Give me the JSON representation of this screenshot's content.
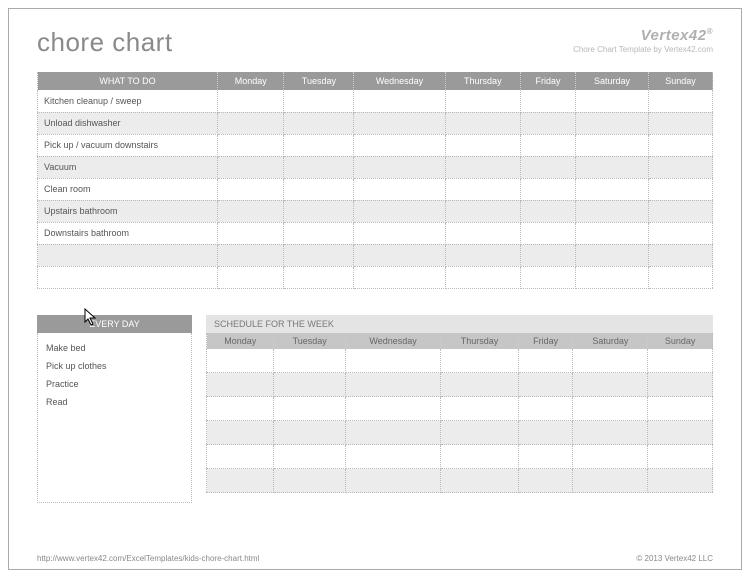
{
  "header": {
    "title": "chore chart",
    "brand_name": "Vertex42",
    "brand_reg": "®",
    "brand_sub": "Chore Chart Template by Vertex42.com"
  },
  "main_table": {
    "col_header": "WHAT TO DO",
    "days": [
      "Monday",
      "Tuesday",
      "Wednesday",
      "Thursday",
      "Friday",
      "Saturday",
      "Sunday"
    ],
    "rows": [
      "Kitchen cleanup / sweep",
      "Unload dishwasher",
      "Pick up / vacuum downstairs",
      "Vacuum",
      "Clean room",
      "Upstairs bathroom",
      "Downstairs bathroom",
      "",
      ""
    ]
  },
  "everyday": {
    "header": "EVERY DAY",
    "items": [
      "Make bed",
      "Pick up clothes",
      "Practice",
      "Read"
    ]
  },
  "schedule": {
    "title": "SCHEDULE FOR THE WEEK",
    "days": [
      "Monday",
      "Tuesday",
      "Wednesday",
      "Thursday",
      "Friday",
      "Saturday",
      "Sunday"
    ],
    "row_count": 6
  },
  "footer": {
    "url": "http://www.vertex42.com/ExcelTemplates/kids-chore-chart.html",
    "copyright": "© 2013 Vertex42 LLC"
  }
}
